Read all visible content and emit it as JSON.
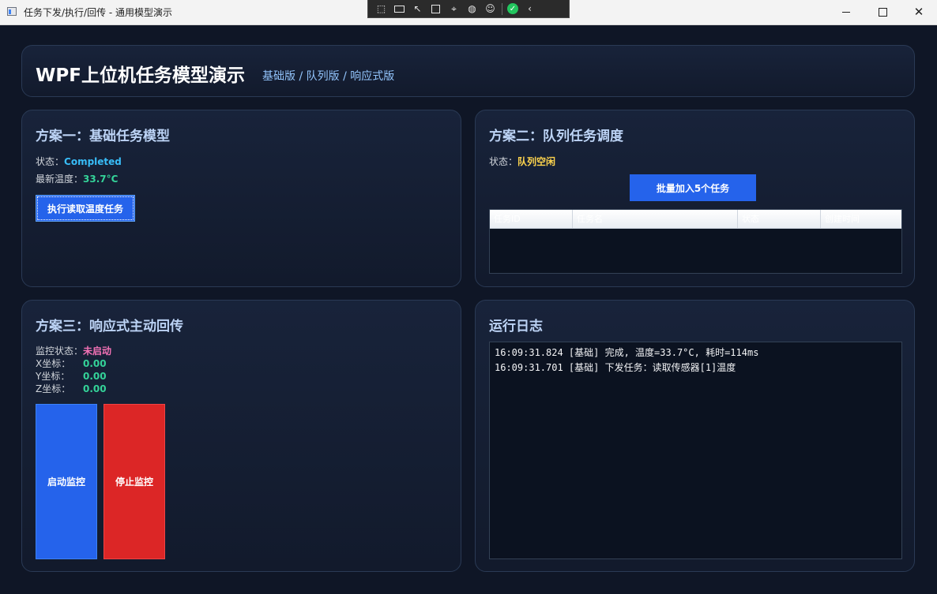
{
  "window": {
    "title": "任务下发/执行/回传 - 通用模型演示",
    "minimize_icon": "minimize-icon",
    "maximize_icon": "maximize-icon",
    "close_glyph": "✕"
  },
  "debug_toolbar": {
    "icons": [
      "select-element-icon",
      "record-icon",
      "pointer-icon",
      "layout-adorner-icon",
      "track-focus-icon",
      "binding-failures-icon",
      "accessibility-icon",
      "ok-check-icon",
      "collapse-chevron-icon"
    ],
    "ok_glyph": "✓",
    "chevron_glyph": "‹"
  },
  "header": {
    "title": "WPF上位机任务模型演示",
    "subtitle": "基础版 / 队列版 / 响应式版"
  },
  "scheme1": {
    "title": "方案一：基础任务模型",
    "status_label": "状态：",
    "status_value": "Completed",
    "temp_label": "最新温度：",
    "temp_value": "33.7°C",
    "button": "执行读取温度任务"
  },
  "scheme2": {
    "title": "方案二：队列任务调度",
    "status_label": "状态：",
    "status_value": "队列空闲",
    "button": "批量加入5个任务",
    "columns": [
      "任务ID",
      "任务名",
      "状态",
      "创建时间"
    ],
    "rows": []
  },
  "scheme3": {
    "title": "方案三：响应式主动回传",
    "monitor_label": "监控状态：",
    "monitor_value": "未启动",
    "x_label": "X坐标：",
    "x_value": "0.00",
    "y_label": "Y坐标：",
    "y_value": "0.00",
    "z_label": "Z坐标：",
    "z_value": "0.00",
    "start_button": "启动监控",
    "stop_button": "停止监控"
  },
  "log": {
    "title": "运行日志",
    "lines": [
      "16:09:31.824 [基础] 完成, 温度=33.7°C, 耗时=114ms",
      "16:09:31.701 [基础] 下发任务：读取传感器[1]温度"
    ]
  },
  "colors": {
    "background": "#0f1626",
    "accent_blue": "#2563eb",
    "danger_red": "#dc2626",
    "status_completed": "#38bdf8",
    "temperature": "#34d399",
    "queue_idle": "#fcd34d",
    "monitor_off": "#f472b6"
  }
}
